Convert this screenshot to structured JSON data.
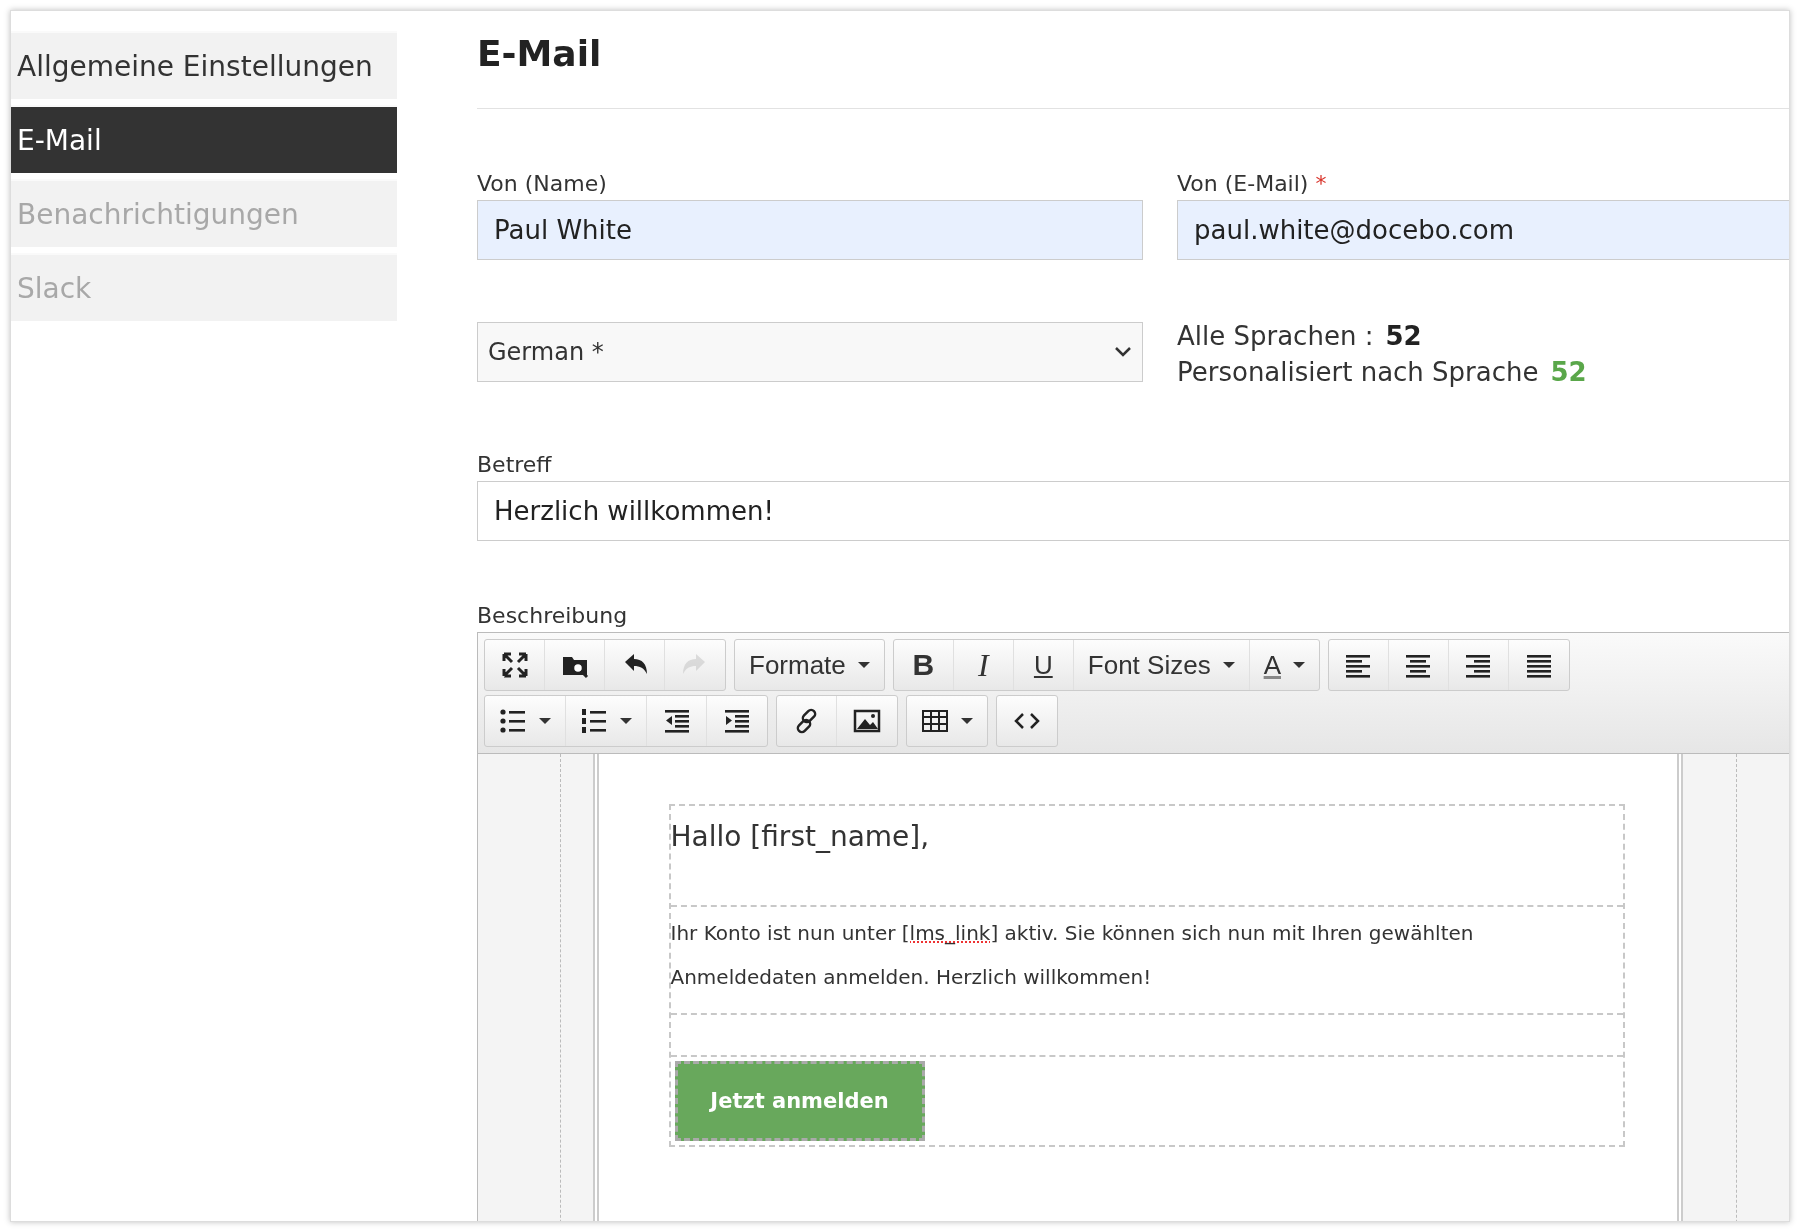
{
  "sidebar": {
    "items": [
      {
        "label": "Allgemeine Einstellungen",
        "selected": false,
        "disabled": false
      },
      {
        "label": "E-Mail",
        "selected": true,
        "disabled": false
      },
      {
        "label": "Benachrichtigungen",
        "selected": false,
        "disabled": true
      },
      {
        "label": "Slack",
        "selected": false,
        "disabled": true
      }
    ]
  },
  "title": "E-Mail",
  "from_name": {
    "label": "Von (Name)",
    "required": false,
    "value": "Paul White"
  },
  "from_email": {
    "label": "Von (E-Mail)",
    "required": true,
    "required_mark": "*",
    "value": "paul.white@docebo.com"
  },
  "language": {
    "value": "German *"
  },
  "counts": [
    {
      "label": "Alle Sprachen :",
      "value": "52",
      "color": "#222222"
    },
    {
      "label": "Personalisiert nach Sprache",
      "value": "52",
      "color": "#5aa74a"
    }
  ],
  "subject": {
    "label": "Betreff",
    "value": "Herzlich willkommen!"
  },
  "description": {
    "label": "Beschreibung",
    "toolbar": [
      [
        [
          {
            "kind": "fullscreen",
            "disabled": false,
            "dropdown": false
          },
          {
            "kind": "browse",
            "disabled": false,
            "dropdown": false
          },
          {
            "kind": "undo",
            "disabled": false,
            "dropdown": false
          },
          {
            "kind": "redo",
            "disabled": true,
            "dropdown": false
          }
        ],
        [
          {
            "kind": "text",
            "label": "Formate",
            "disabled": false,
            "dropdown": true
          }
        ],
        [
          {
            "kind": "bold",
            "label": "B",
            "disabled": false,
            "dropdown": false
          },
          {
            "kind": "italic",
            "label": "I",
            "disabled": false,
            "dropdown": false
          },
          {
            "kind": "underline",
            "label": "U",
            "disabled": false,
            "dropdown": false
          },
          {
            "kind": "text",
            "label": "Font Sizes",
            "disabled": false,
            "dropdown": true
          },
          {
            "kind": "color",
            "label": "A",
            "disabled": false,
            "dropdown": true
          }
        ],
        [
          {
            "kind": "align-left",
            "disabled": false,
            "dropdown": false
          },
          {
            "kind": "align-center",
            "disabled": false,
            "dropdown": false
          },
          {
            "kind": "align-right",
            "disabled": false,
            "dropdown": false
          },
          {
            "kind": "justify",
            "disabled": false,
            "dropdown": false
          }
        ]
      ],
      [
        [
          {
            "kind": "bullet-list",
            "disabled": false,
            "dropdown": true
          },
          {
            "kind": "numbered-list",
            "disabled": false,
            "dropdown": true
          },
          {
            "kind": "outdent",
            "disabled": false,
            "dropdown": false
          },
          {
            "kind": "indent",
            "disabled": false,
            "dropdown": false
          }
        ],
        [
          {
            "kind": "link",
            "disabled": false,
            "dropdown": false
          },
          {
            "kind": "image",
            "disabled": false,
            "dropdown": false
          }
        ],
        [
          {
            "kind": "table",
            "disabled": false,
            "dropdown": true
          }
        ],
        [
          {
            "kind": "code",
            "disabled": false,
            "dropdown": false
          }
        ]
      ]
    ],
    "content": {
      "greeting": "Hallo [first_name],",
      "paragraph": [
        {
          "text": "Ihr Konto ist nun unter ",
          "misspelled": false
        },
        {
          "text": "[lms_link]",
          "misspelled": true
        },
        {
          "text": " aktiv. Sie können sich nun mit Ihren gewählten Anmeldedaten anmelden. Herzlich willkommen!",
          "misspelled": false
        }
      ],
      "button": "Jetzt anmelden"
    }
  }
}
